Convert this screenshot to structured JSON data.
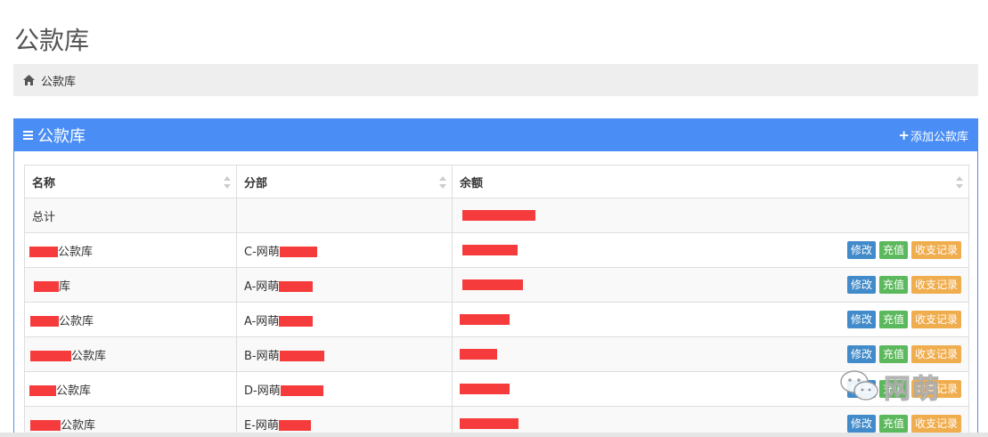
{
  "page": {
    "title": "公款库"
  },
  "breadcrumb": {
    "icon": "home-icon",
    "label": "公款库"
  },
  "panel": {
    "title": "公款库",
    "menu_icon": "menu-icon",
    "add_label": "添加公款库",
    "accent": "#4a8ef5"
  },
  "table": {
    "headers": [
      "名称",
      "分部",
      "余额"
    ],
    "total": {
      "name": "总计",
      "branch": "",
      "balance": ""
    },
    "rows": [
      {
        "name": "公款库",
        "branch": "C-网萌"
      },
      {
        "name": "库",
        "branch": "A-网萌"
      },
      {
        "name": "公款库",
        "branch": "A-网萌"
      },
      {
        "name": "公款库",
        "branch": "B-网萌"
      },
      {
        "name": "公款库",
        "branch": "D-网萌"
      },
      {
        "name": "公款库",
        "branch": "E-网萌"
      }
    ],
    "actions": {
      "edit": "修改",
      "charge": "充值",
      "record": "收支记录"
    }
  },
  "colors": {
    "edit": "#428bca",
    "charge": "#5cb85c",
    "record": "#f0ad4e",
    "redaction": "#f53b3b"
  },
  "watermark": {
    "text": "网萌",
    "icon": "wechat-icon"
  }
}
